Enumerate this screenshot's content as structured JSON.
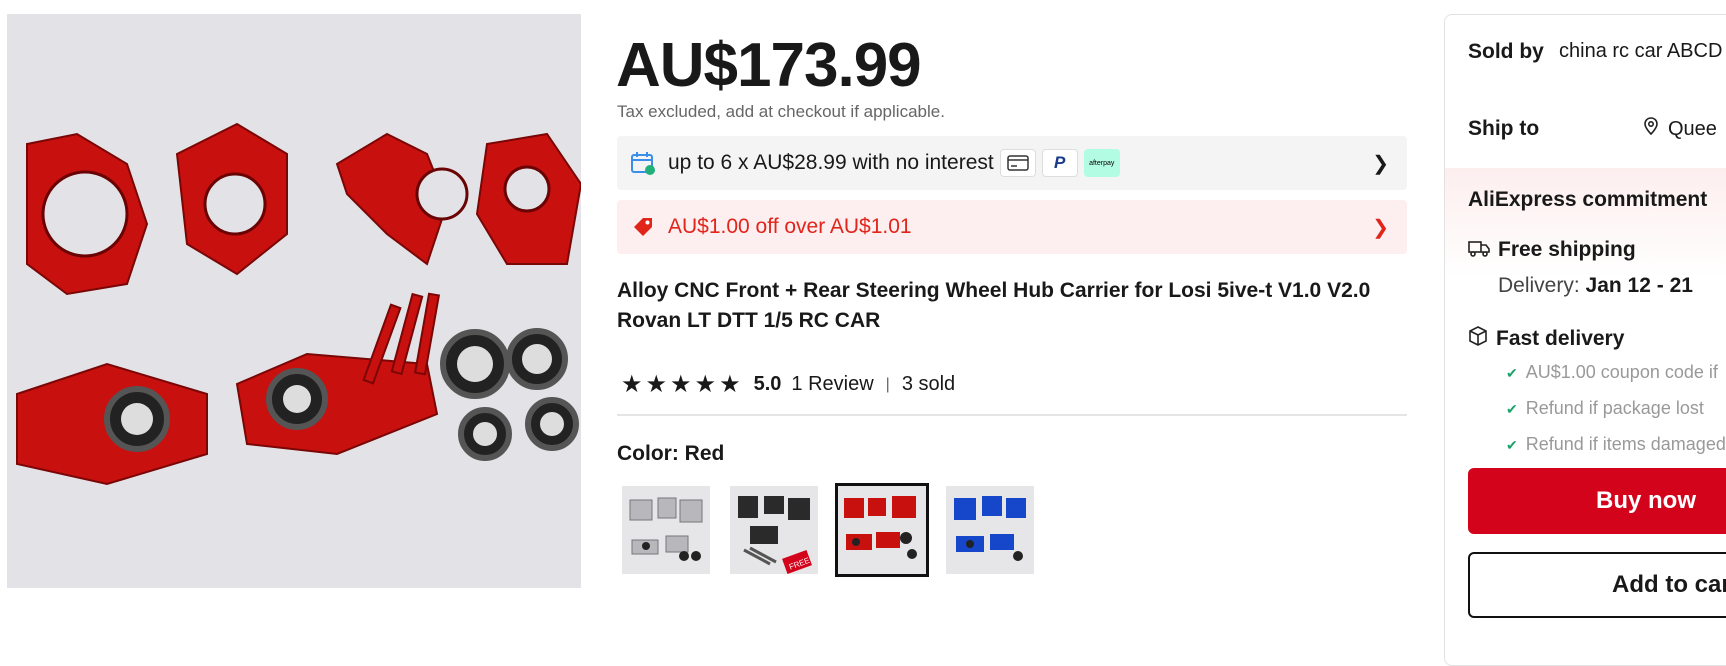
{
  "price": "AU$173.99",
  "tax_note": "Tax excluded, add at checkout if applicable.",
  "installment": {
    "text": "up to 6 x AU$28.99 with no interest",
    "afterpay_label": "afterpay"
  },
  "coupon": {
    "text": "AU$1.00 off over AU$1.01"
  },
  "title": "Alloy CNC Front + Rear Steering Wheel Hub Carrier for Losi 5ive-t V1.0 V2.0 Rovan LT DTT 1/5 RC CAR",
  "rating": {
    "stars": 5,
    "score": "5.0",
    "reviews": "1 Review",
    "sold": "3 sold"
  },
  "color": {
    "label": "Color:",
    "value": "Red",
    "options": [
      "Silver",
      "Black",
      "Red",
      "Blue"
    ],
    "selected_index": 2
  },
  "thumb_badge": "FREE",
  "panel": {
    "sold_by_label": "Sold by",
    "seller": "china rc car ABCD",
    "ship_to_label": "Ship to",
    "ship_to_value": "Quee",
    "commitment": "AliExpress commitment",
    "free_shipping": "Free shipping",
    "delivery_label": "Delivery:",
    "delivery_value": "Jan 12 - 21",
    "fast_delivery": "Fast delivery",
    "perks": [
      "AU$1.00 coupon code if",
      "Refund if package lost",
      "Refund if items damaged"
    ],
    "buy_now": "Buy now",
    "add_to_cart": "Add to car"
  },
  "colors": {
    "accent": "#d3031c",
    "coupon_red": "#e1251b",
    "check_green": "#1aa36b"
  }
}
